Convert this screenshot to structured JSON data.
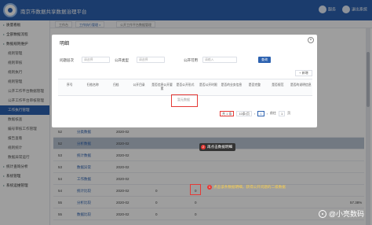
{
  "app": {
    "title": "南京市数据共享数据治理平台",
    "user": "服务",
    "logout": "退出系统"
  },
  "sidebar": {
    "items": [
      {
        "label": "质量看板",
        "type": "group"
      },
      {
        "label": "全部数据流程",
        "type": "group"
      },
      {
        "label": "数据规则维护",
        "type": "group"
      },
      {
        "label": "规则管理",
        "type": "item"
      },
      {
        "label": "规则审核",
        "type": "item"
      },
      {
        "label": "规则执行",
        "type": "item"
      },
      {
        "label": "规则管理",
        "type": "item"
      },
      {
        "label": "公开工作平台数据管理",
        "type": "item"
      },
      {
        "label": "公开工作平台审核管理",
        "type": "item"
      },
      {
        "label": "工作执行管理",
        "type": "active"
      },
      {
        "label": "数据核查",
        "type": "item"
      },
      {
        "label": "编号审核工作管理",
        "type": "item"
      },
      {
        "label": "报告查看",
        "type": "item"
      },
      {
        "label": "规则统计",
        "type": "item"
      },
      {
        "label": "数据异常运行",
        "type": "item"
      },
      {
        "label": "统计查询分析",
        "type": "group"
      },
      {
        "label": "系统管理",
        "type": "group"
      },
      {
        "label": "系统运维管理",
        "type": "group"
      }
    ]
  },
  "tabs": [
    "工作台",
    "工作执行管理 ×",
    "公开工作平台数据管理"
  ],
  "main_rows": [
    {
      "no": "52",
      "name": "分类数据",
      "date": "2020-02",
      "v1": "",
      "v2": "",
      "pct": "",
      "hl": false
    },
    {
      "no": "52",
      "name": "分析数据",
      "date": "2020-02",
      "v1": "",
      "v2": "",
      "pct": "",
      "hl": true
    },
    {
      "no": "53",
      "name": "统计数据",
      "date": "2020-02",
      "v1": "",
      "v2": "",
      "pct": "",
      "hl": false
    },
    {
      "no": "53",
      "name": "数据异常",
      "date": "2020-02",
      "v1": "",
      "v2": "",
      "pct": "",
      "hl": false
    },
    {
      "no": "54",
      "name": "工作数据",
      "date": "2020-02",
      "v1": "",
      "v2": "",
      "pct": "",
      "hl": false
    },
    {
      "no": "54",
      "name": "统计比较",
      "date": "2020-02",
      "v1": "0",
      "v2": "0",
      "pct": "",
      "hl": false
    },
    {
      "no": "55",
      "name": "分析比较",
      "date": "2020-02",
      "v1": "0",
      "v2": "0",
      "pct": "57.38%",
      "hl": false
    },
    {
      "no": "55",
      "name": "数据比较",
      "date": "2020-02",
      "v1": "0",
      "v2": "0",
      "pct": "",
      "hl": false
    }
  ],
  "modal": {
    "title": "明细",
    "filters": [
      {
        "label": "问题层次",
        "placeholder": "请选择"
      },
      {
        "label": "公开类型",
        "placeholder": "请选择"
      },
      {
        "label": "公开可用",
        "placeholder": "请输入"
      }
    ],
    "query_btn": "查询",
    "add_btn": "+ 新增",
    "columns": [
      "序号",
      "归档名称",
      "归档",
      "公开目录",
      "是否信息公开要素",
      "是否公开形式",
      "是否公开时限",
      "是否的业务信息",
      "是否完整",
      "是否规范",
      "是否的说明信息"
    ],
    "no_data": "暂无数据",
    "pager": {
      "total": "共 1 条",
      "size": "10条/页",
      "page": "1",
      "goto_label": "前往",
      "goto_page": "1",
      "unit": "页"
    }
  },
  "tips": {
    "step2": {
      "num": "2",
      "text": "再点击数据明细"
    },
    "step1": {
      "num": "1",
      "text": "点击该条数据明细，获得公开问题的二级数据"
    }
  },
  "watermark": "@小亮数码"
}
